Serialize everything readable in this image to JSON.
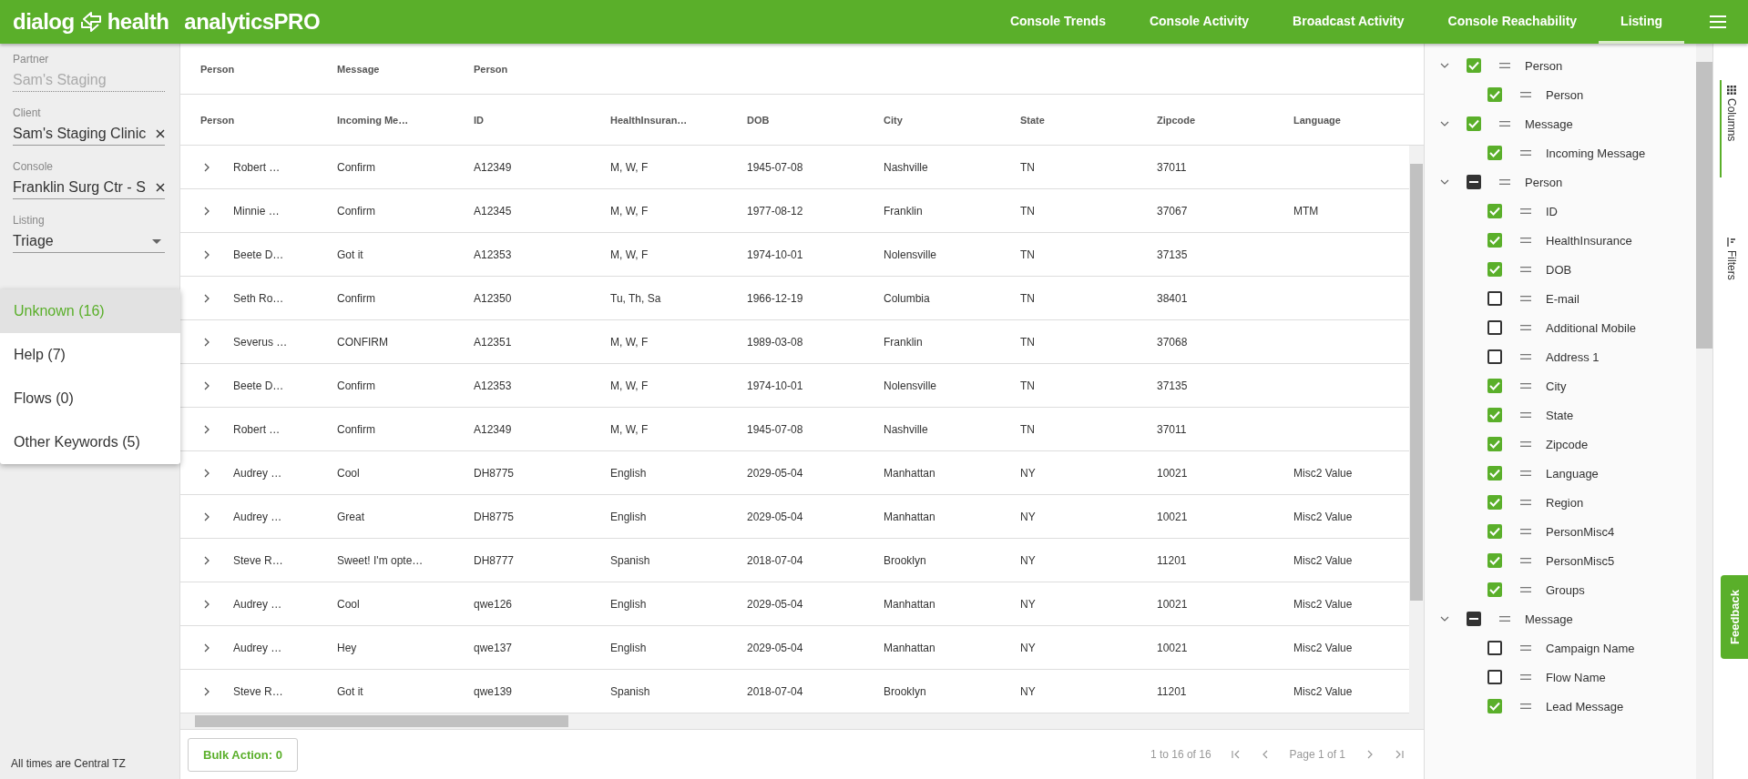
{
  "brand": {
    "word_1": "dialog",
    "word_2": "health",
    "product": "analyticsPRO"
  },
  "nav": [
    {
      "label": "Console Trends",
      "selected": false
    },
    {
      "label": "Console Activity",
      "selected": false
    },
    {
      "label": "Broadcast Activity",
      "selected": false
    },
    {
      "label": "Console Reachability",
      "selected": false
    },
    {
      "label": "Listing",
      "selected": true
    }
  ],
  "sidebar": {
    "fields": [
      {
        "kind": "disabled",
        "label": "Partner",
        "value": "Sam's Staging"
      },
      {
        "kind": "clearable",
        "label": "Client",
        "value": "Sam's Staging Clinic"
      },
      {
        "kind": "clearable",
        "label": "Console",
        "value": "Franklin Surg Ctr - S"
      },
      {
        "kind": "select",
        "label": "Listing",
        "value": "Triage"
      }
    ],
    "menu": [
      {
        "label": "Unknown (16)",
        "selected": true
      },
      {
        "label": "Help (7)",
        "selected": false
      },
      {
        "label": "Flows (0)",
        "selected": false
      },
      {
        "label": "Other Keywords (5)",
        "selected": false
      }
    ],
    "footnote": "All times are Central TZ"
  },
  "table": {
    "groups": [
      "Person",
      "Message",
      "Person"
    ],
    "columns": [
      "Person",
      "Incoming Me…",
      "ID",
      "HealthInsuran…",
      "DOB",
      "City",
      "State",
      "Zipcode",
      "Language"
    ],
    "rows": [
      [
        "Robert …",
        "Confirm",
        "A12349",
        "M, W, F",
        "1945-07-08",
        "Nashville",
        "TN",
        "37011",
        ""
      ],
      [
        "Minnie …",
        "Confirm",
        "A12345",
        "M, W, F",
        "1977-08-12",
        "Franklin",
        "TN",
        "37067",
        "MTM"
      ],
      [
        "Beete D…",
        "Got it",
        "A12353",
        "M, W, F",
        "1974-10-01",
        "Nolensville",
        "TN",
        "37135",
        ""
      ],
      [
        "Seth Ro…",
        "Confirm",
        "A12350",
        "Tu, Th, Sa",
        "1966-12-19",
        "Columbia",
        "TN",
        "38401",
        ""
      ],
      [
        "Severus …",
        "CONFIRM",
        "A12351",
        "M, W, F",
        "1989-03-08",
        "Franklin",
        "TN",
        "37068",
        ""
      ],
      [
        "Beete D…",
        "Confirm",
        "A12353",
        "M, W, F",
        "1974-10-01",
        "Nolensville",
        "TN",
        "37135",
        ""
      ],
      [
        "Robert …",
        "Confirm",
        "A12349",
        "M, W, F",
        "1945-07-08",
        "Nashville",
        "TN",
        "37011",
        ""
      ],
      [
        "Audrey …",
        "Cool",
        "DH8775",
        "English",
        "2029-05-04",
        "Manhattan",
        "NY",
        "10021",
        "Misc2 Value"
      ],
      [
        "Audrey …",
        "Great",
        "DH8775",
        "English",
        "2029-05-04",
        "Manhattan",
        "NY",
        "10021",
        "Misc2 Value"
      ],
      [
        "Steve R…",
        "Sweet! I'm opte…",
        "DH8777",
        "Spanish",
        "2018-07-04",
        "Brooklyn",
        "NY",
        "11201",
        "Misc2 Value"
      ],
      [
        "Audrey …",
        "Cool",
        "qwe126",
        "English",
        "2029-05-04",
        "Manhattan",
        "NY",
        "10021",
        "Misc2 Value"
      ],
      [
        "Audrey …",
        "Hey",
        "qwe137",
        "English",
        "2029-05-04",
        "Manhattan",
        "NY",
        "10021",
        "Misc2 Value"
      ],
      [
        "Steve R…",
        "Got it",
        "qwe139",
        "Spanish",
        "2018-07-04",
        "Brooklyn",
        "NY",
        "11201",
        "Misc2 Value"
      ]
    ]
  },
  "bulk_action": "Bulk Action: 0",
  "pagination": {
    "range": "1 to 16 of 16",
    "page": "Page 1 of 1"
  },
  "column_tree": [
    {
      "label": "Person",
      "expanded": true,
      "checked": true,
      "indeterminate": false,
      "children": [
        {
          "label": "Person",
          "checked": true
        }
      ]
    },
    {
      "label": "Message",
      "expanded": true,
      "checked": true,
      "indeterminate": false,
      "children": [
        {
          "label": "Incoming Message",
          "checked": true
        }
      ]
    },
    {
      "label": "Person",
      "expanded": true,
      "checked": true,
      "indeterminate": true,
      "children": [
        {
          "label": "ID",
          "checked": true
        },
        {
          "label": "HealthInsurance",
          "checked": true
        },
        {
          "label": "DOB",
          "checked": true
        },
        {
          "label": "E-mail",
          "checked": false
        },
        {
          "label": "Additional Mobile",
          "checked": false
        },
        {
          "label": "Address 1",
          "checked": false
        },
        {
          "label": "City",
          "checked": true
        },
        {
          "label": "State",
          "checked": true
        },
        {
          "label": "Zipcode",
          "checked": true
        },
        {
          "label": "Language",
          "checked": true
        },
        {
          "label": "Region",
          "checked": true
        },
        {
          "label": "PersonMisc4",
          "checked": true
        },
        {
          "label": "PersonMisc5",
          "checked": true
        },
        {
          "label": "Groups",
          "checked": true
        }
      ]
    },
    {
      "label": "Message",
      "expanded": true,
      "checked": true,
      "indeterminate": true,
      "children": [
        {
          "label": "Campaign Name",
          "checked": false
        },
        {
          "label": "Flow Name",
          "checked": false
        },
        {
          "label": "Lead Message",
          "checked": true
        }
      ]
    }
  ],
  "side_tabs": [
    {
      "label": "Columns",
      "selected": true
    },
    {
      "label": "Filters",
      "selected": false
    }
  ],
  "feedback": "Feedback"
}
